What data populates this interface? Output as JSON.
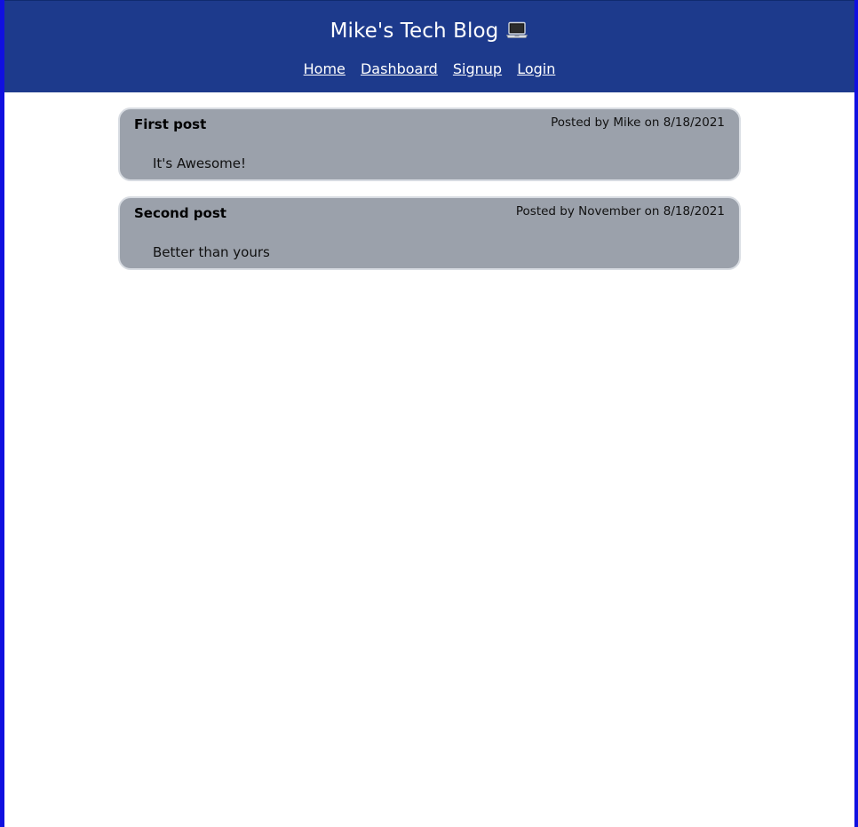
{
  "header": {
    "title": "Mike's Tech Blog",
    "title_icon": "laptop-icon",
    "bg_color": "#1d3a8c"
  },
  "nav": {
    "items": [
      {
        "label": "Home"
      },
      {
        "label": "Dashboard"
      },
      {
        "label": "Signup"
      },
      {
        "label": "Login"
      }
    ]
  },
  "posts": [
    {
      "title": "First post",
      "meta": "Posted by Mike on 8/18/2021",
      "body": "It's Awesome!"
    },
    {
      "title": "Second post",
      "meta": "Posted by November on 8/18/2021",
      "body": "Better than yours"
    }
  ],
  "colors": {
    "frame_border": "#1010e0",
    "post_bg": "#9ba1ab"
  }
}
